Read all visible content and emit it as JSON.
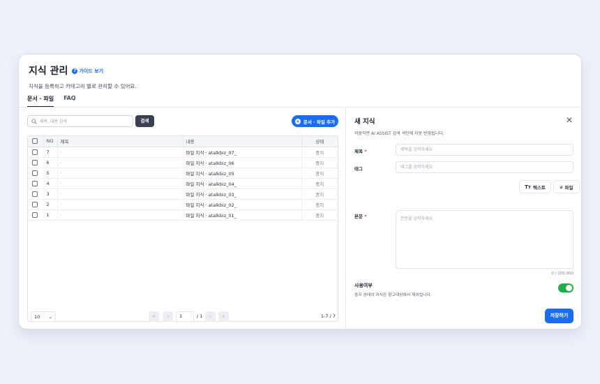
{
  "header": {
    "title": "지식 관리",
    "guide_label": "가이드 보기",
    "subtitle": "지식을 등록하고 카테고리 별로 관리할 수 있어요."
  },
  "tabs": [
    {
      "label": "문서 · 파일",
      "active": true
    },
    {
      "label": "FAQ",
      "active": false
    }
  ],
  "toolbar": {
    "search_placeholder": "제목, 내용 검색",
    "search_button": "검색",
    "add_button": "문서 · 파일 추가"
  },
  "table": {
    "columns": [
      "NO",
      "제목",
      "내용",
      "상태"
    ],
    "rows": [
      {
        "no": "7",
        "title": "·",
        "content": "파일 지식 · atalkbiz_07_",
        "status": "중지"
      },
      {
        "no": "6",
        "title": "·",
        "content": "파일 지식 · atalkbiz_06",
        "status": "중지"
      },
      {
        "no": "5",
        "title": "·",
        "content": "파일 지식 · atalkbiz_05",
        "status": "중지"
      },
      {
        "no": "4",
        "title": "·",
        "content": "파일 지식 · atalkbiz_04_",
        "status": "중지"
      },
      {
        "no": "3",
        "title": "·",
        "content": "파일 지식 · atalkbiz_03_",
        "status": "중지"
      },
      {
        "no": "2",
        "title": "·",
        "content": "파일 지식 · atalkbiz_02_",
        "status": "중지"
      },
      {
        "no": "1",
        "title": "·",
        "content": "파일 지식 · atalkbiz_01_",
        "status": "중지"
      }
    ]
  },
  "pager": {
    "page_size": "10",
    "first": "«",
    "prev": "‹",
    "current_page": "1",
    "total_pages": "/ 1",
    "next": "›",
    "last": "»",
    "range": "1-7 / 7"
  },
  "panel": {
    "title": "새 지식",
    "subtitle": "저장하면 AI ASSIST 검색 색인에 자동 반영됩니다.",
    "title_label": "제목",
    "title_placeholder": "제목을 입력하세요",
    "tag_label": "태그",
    "tag_placeholder": "태그를 입력하세요",
    "text_button": "텍스트",
    "file_button": "파일",
    "body_label": "본문",
    "body_placeholder": "본문을 입력하세요",
    "char_count": "0 / 200,000",
    "use_label": "사용여부",
    "use_sub": "중지 상태의 지식은 참고대상에서 제외됩니다.",
    "use_enabled": true,
    "save_button": "저장하기",
    "required_mark": "*"
  },
  "colors": {
    "accent": "#1a6cf0",
    "toggle_on": "#1fae4a",
    "dark_button": "#3a3f52"
  }
}
